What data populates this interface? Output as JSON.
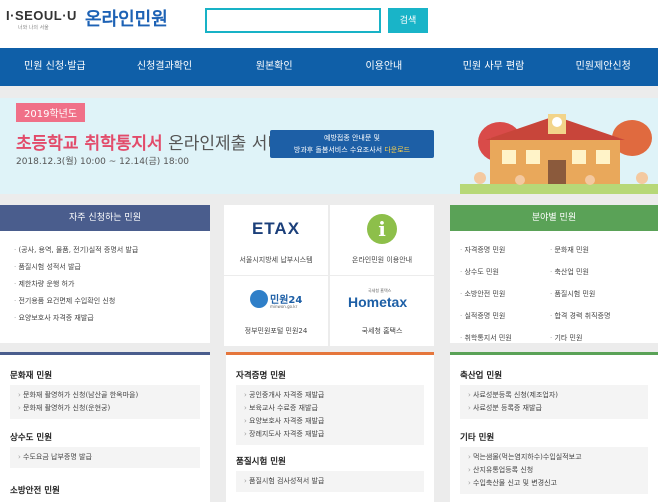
{
  "header": {
    "logo_mark": "I·SEOUL·U",
    "logo_sub": "너와 나의 서울",
    "site_title": "온라인민원",
    "search_button": "검색"
  },
  "nav": [
    "민원 신청·발급",
    "신청결과확인",
    "원본확인",
    "이용안내",
    "민원 사무 편람",
    "민원제안신청"
  ],
  "banner": {
    "year": "2019학년도",
    "title_a": "초등학교 취학통지서",
    "title_b": " 온라인제출 서비스",
    "date": "2018.12.3(월) 10:00 ~ 12.14(금) 18:00",
    "cta_line1": "예방접종 안내문 및",
    "cta_line2": "방과후 돌봄서비스 수요조사서 ",
    "cta_hl": "다운로드"
  },
  "frequent": {
    "head": "자주 신청하는 민원",
    "items": [
      "(공사, 용역, 물품, 전기)실적 증명서 발급",
      "품질시험 성적서 발급",
      "제한차량 운행 허가",
      "전기용품 요건면제 수입확인 신청",
      "요양보호사 자격증 재발급"
    ]
  },
  "tiles": [
    {
      "logo": "ETAX",
      "cap": "서울시지방세 납부시스템"
    },
    {
      "logo": "i",
      "cap": "온라인민원 이용안내"
    },
    {
      "logo": "민원24",
      "logo_sub": "minwon.go.kr",
      "cap": "정부민원포털 민원24"
    },
    {
      "logo": "Hometax",
      "logo_sub": "국세청 홈택스",
      "cap": "국세청 홈택스"
    }
  ],
  "category": {
    "head": "분야별 민원",
    "items": [
      "자격증명 민원",
      "문화재 민원",
      "상수도 민원",
      "축산업 민원",
      "소방안전 민원",
      "품질시험 민원",
      "실적증명 민원",
      "합격 경력 취직증명",
      "취학통지서 민원",
      "기타 민원"
    ]
  },
  "sections": {
    "left": [
      {
        "title": "문화재 민원",
        "items": [
          "문화재 촬영허가 신청(남산골 한옥마을)",
          "문화재 촬영허가 신청(운현궁)"
        ]
      },
      {
        "title": "상수도 민원",
        "items": [
          "수도요금 납부증명 발급"
        ]
      },
      {
        "title": "소방안전 민원",
        "items": []
      }
    ],
    "middle": [
      {
        "title": "자격증명 민원",
        "items": [
          "공인중개사 자격증 재발급",
          "보육교사 수료증 재발급",
          "요양보호사 자격증 재발급",
          "장례지도사 자격증 재발급"
        ]
      },
      {
        "title": "품질시험 민원",
        "items": [
          "품질시험 검사성적서 발급"
        ]
      }
    ],
    "right": [
      {
        "title": "축산업 민원",
        "items": [
          "사료성분등록 신청(제조업자)",
          "사료성분 등록증 재발급"
        ]
      },
      {
        "title": "기타 민원",
        "items": [
          "먹는샘물(먹는염지하수)수입실적보고",
          "산지유통업등록 신청",
          "수입축산물 신고 및 변경신고"
        ]
      }
    ]
  },
  "colors": {
    "nav": "#0f5fa8",
    "frequent_head": "#4a5d8d",
    "category_head": "#5aa257",
    "accent_teal": "#19b4c8"
  }
}
